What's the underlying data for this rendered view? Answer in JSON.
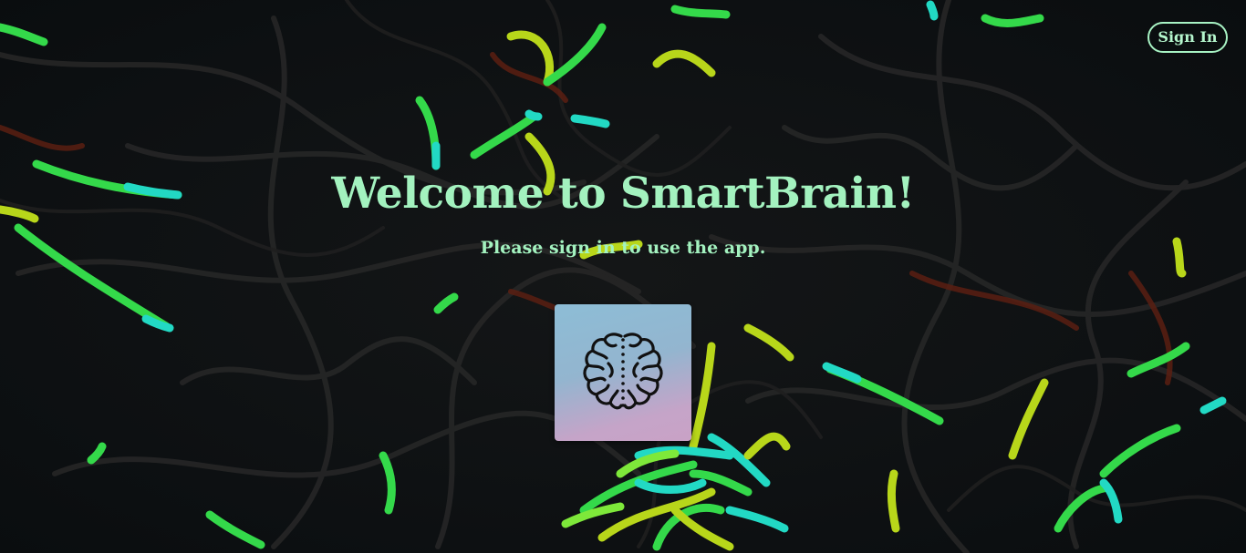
{
  "nav": {
    "sign_in_label": "Sign In"
  },
  "hero": {
    "title": "Welcome to SmartBrain!",
    "subtitle": "Please sign in to use the app."
  },
  "logo": {
    "icon": "brain-icon"
  },
  "background": {
    "description_icon": "particle-strands",
    "colors": [
      "#2b2b2b",
      "#39e04a",
      "#c4dd1b",
      "#23d8c8",
      "#7a2a17"
    ]
  }
}
